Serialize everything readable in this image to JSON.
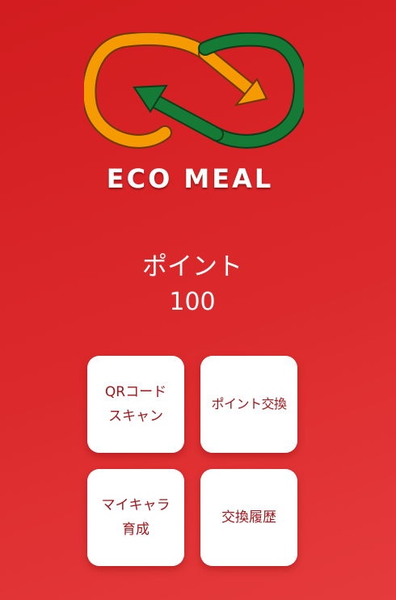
{
  "app": {
    "brand_name": "ECO MEAL",
    "logo_icon": "recycle-infinity-arrows-icon"
  },
  "points": {
    "label": "ポイント",
    "value": "100"
  },
  "menu": {
    "qr_scan": "QRコード\nスキャン",
    "point_exchange": "ポイント交換",
    "my_character": "マイキャラ\n育成",
    "exchange_history": "交換履歴"
  },
  "colors": {
    "background": "#d8232a",
    "button_bg": "#ffffff",
    "button_text": "#a3161a",
    "logo_orange": "#f59a00",
    "logo_green": "#157a35"
  }
}
